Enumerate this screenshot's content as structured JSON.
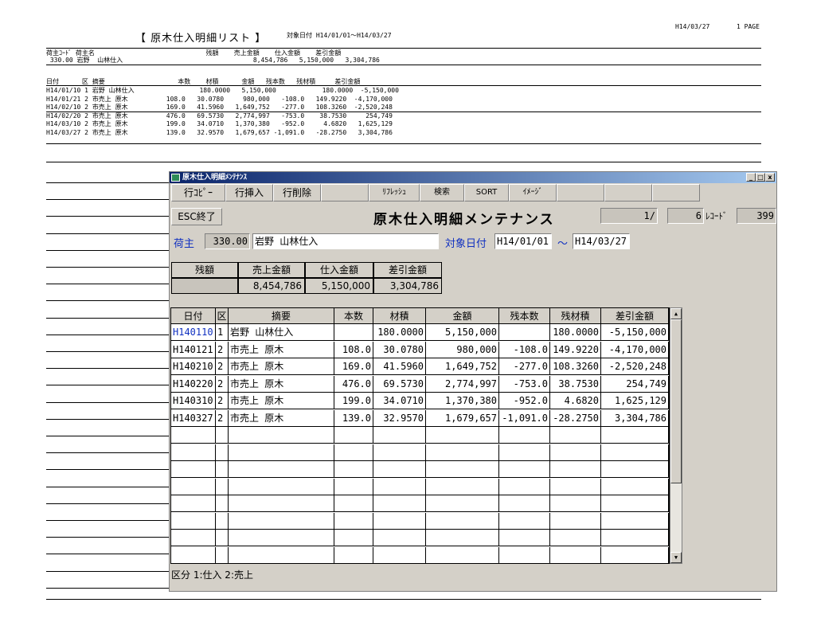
{
  "report": {
    "title": "【 原木仕入明細リスト 】",
    "date_range": "対象日付 H14/01/01～H14/03/27",
    "print_date": "H14/03/27",
    "page": "1 PAGE",
    "head1": "荷主ｺｰﾄﾞ 荷主名                             残額    売上金額    仕入金額    差引金額",
    "head1_vals": " 330.00 岩野  山林仕入                                  8,454,786   5,150,000   3,304,786",
    "head2": "日付      区 摘要                   本数    材積      金額   残本数   残材積     差引金額",
    "lines": [
      "H14/01/10 1 岩野 山林仕入                 180.0000   5,150,000            180.0000  -5,150,000",
      "H14/01/21 2 市売上 原木          108.0   30.0780     980,000   -108.0   149.9220  -4,170,000",
      "H14/02/10 2 市売上 原木          169.0   41.5960   1,649,752   -277.0   108.3260  -2,520,248",
      "H14/02/20 2 市売上 原木          476.0   69.5730   2,774,997   -753.0    38.7530     254,749",
      "H14/03/10 2 市売上 原木          199.0   34.0710   1,370,380   -952.0     4.6820   1,625,129",
      "H14/03/27 2 市売上 原木          139.0   32.9570   1,679,657 -1,091.0   -28.2750   3,304,786"
    ]
  },
  "window": {
    "title": "原木仕入明細ﾒﾝﾃﾅﾝｽ",
    "min": "_",
    "max": "□",
    "close": "x",
    "toolbar": [
      "行ｺﾋﾟｰ",
      "行挿入",
      "行削除",
      "",
      "ﾘﾌﾚｯｼｭ",
      "検索",
      "SORT",
      "ｲﾒｰｼﾞ",
      "",
      "",
      ""
    ],
    "esc_label": "ESC終了",
    "heading": "原木仕入明細メンテナンス",
    "record_pos": "1/",
    "record_count": "6",
    "record_label": "ﾚｺｰﾄﾞ",
    "record_extra": "399",
    "owner_label": "荷主",
    "owner_code": "330.00",
    "owner_name": "岩野  山林仕入",
    "date_label": "対象日付",
    "date_from": "H14/01/01",
    "date_sep": "～",
    "date_to": "H14/03/27",
    "summary_headers": [
      "残額",
      "売上金額",
      "仕入金額",
      "差引金額"
    ],
    "summary_values": [
      "",
      "8,454,786",
      "5,150,000",
      "3,304,786"
    ],
    "grid_headers": [
      "日付",
      "区",
      "摘要",
      "本数",
      "材積",
      "金額",
      "残本数",
      "残材積",
      "差引金額"
    ],
    "rows": [
      [
        "H140110",
        "1",
        "岩野 山林仕入",
        "",
        "180.0000",
        "5,150,000",
        "",
        "180.0000",
        "-5,150,000"
      ],
      [
        "H140121",
        "2",
        "市売上 原木",
        "108.0",
        "30.0780",
        "980,000",
        "-108.0",
        "149.9220",
        "-4,170,000"
      ],
      [
        "H140210",
        "2",
        "市売上 原木",
        "169.0",
        "41.5960",
        "1,649,752",
        "-277.0",
        "108.3260",
        "-2,520,248"
      ],
      [
        "H140220",
        "2",
        "市売上 原木",
        "476.0",
        "69.5730",
        "2,774,997",
        "-753.0",
        "38.7530",
        "254,749"
      ],
      [
        "H140310",
        "2",
        "市売上 原木",
        "199.0",
        "34.0710",
        "1,370,380",
        "-952.0",
        "4.6820",
        "1,625,129"
      ],
      [
        "H140327",
        "2",
        "市売上 原木",
        "139.0",
        "32.9570",
        "1,679,657",
        "-1,091.0",
        "-28.2750",
        "3,304,786"
      ]
    ],
    "footer": "区分 1:仕入 2:売上",
    "scroll_up": "▲",
    "scroll_down": "▼"
  }
}
